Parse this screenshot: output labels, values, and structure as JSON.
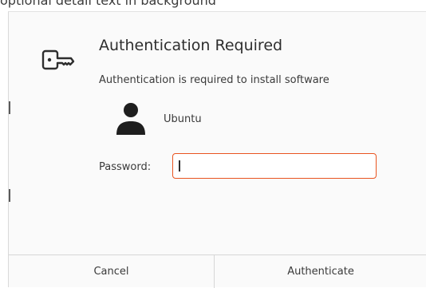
{
  "background_window": {
    "partial_text": "optional detail text in background"
  },
  "dialog": {
    "icon": "key-icon",
    "title": "Authentication Required",
    "message": "Authentication is required to install software",
    "user": {
      "avatar_icon": "user-avatar-icon",
      "name": "Ubuntu"
    },
    "password": {
      "label": "Password:",
      "value": "",
      "focused": true
    },
    "buttons": {
      "cancel": "Cancel",
      "authenticate": "Authenticate"
    }
  },
  "colors": {
    "accent": "#e95420",
    "background": "#fafafa",
    "text": "#3a3a3a"
  }
}
